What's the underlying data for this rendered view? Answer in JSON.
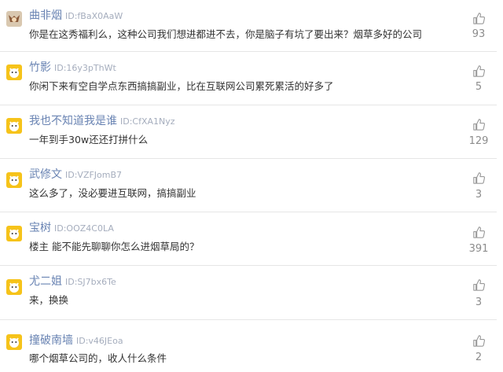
{
  "comments": [
    {
      "username": "曲非烟",
      "user_id": "ID:fBaX0AaW",
      "text": "你是在这秀福利么，这种公司我们想进都进不去，你是脑子有坑了要出来？烟草多好的公司",
      "likes": "93",
      "avatar": "custom-avatar"
    },
    {
      "username": "竹影",
      "user_id": "ID:16y3pThWt",
      "text": "你闲下来有空自学点东西搞搞副业，比在互联网公司累死累活的好多了",
      "likes": "5",
      "avatar": "default-avatar"
    },
    {
      "username": "我也不知道我是谁",
      "user_id": "ID:CfXA1Nyz",
      "text": "一年到手30w还还打拼什么",
      "likes": "129",
      "avatar": "default-avatar"
    },
    {
      "username": "武修文",
      "user_id": "ID:VZFJomB7",
      "text": "这么多了，没必要进互联网，搞搞副业",
      "likes": "3",
      "avatar": "default-avatar"
    },
    {
      "username": "宝树",
      "user_id": "ID:OOZ4C0LA",
      "text": "楼主 能不能先聊聊你怎么进烟草局的？",
      "likes": "391",
      "avatar": "default-avatar"
    },
    {
      "username": "尤二姐",
      "user_id": "ID:SJ7bx6Te",
      "text": "来，换换",
      "likes": "3",
      "avatar": "default-avatar"
    },
    {
      "username": "撞破南墙",
      "user_id": "ID:v46JEoa",
      "text": "哪个烟草公司的，收人什么条件",
      "likes": "2",
      "avatar": "default-avatar"
    }
  ],
  "icons": {
    "like": "thumbs-up-icon"
  },
  "colors": {
    "username": "#6a84b3",
    "user_id": "#a5adbd",
    "text": "#333333",
    "count": "#8c8c8c"
  }
}
